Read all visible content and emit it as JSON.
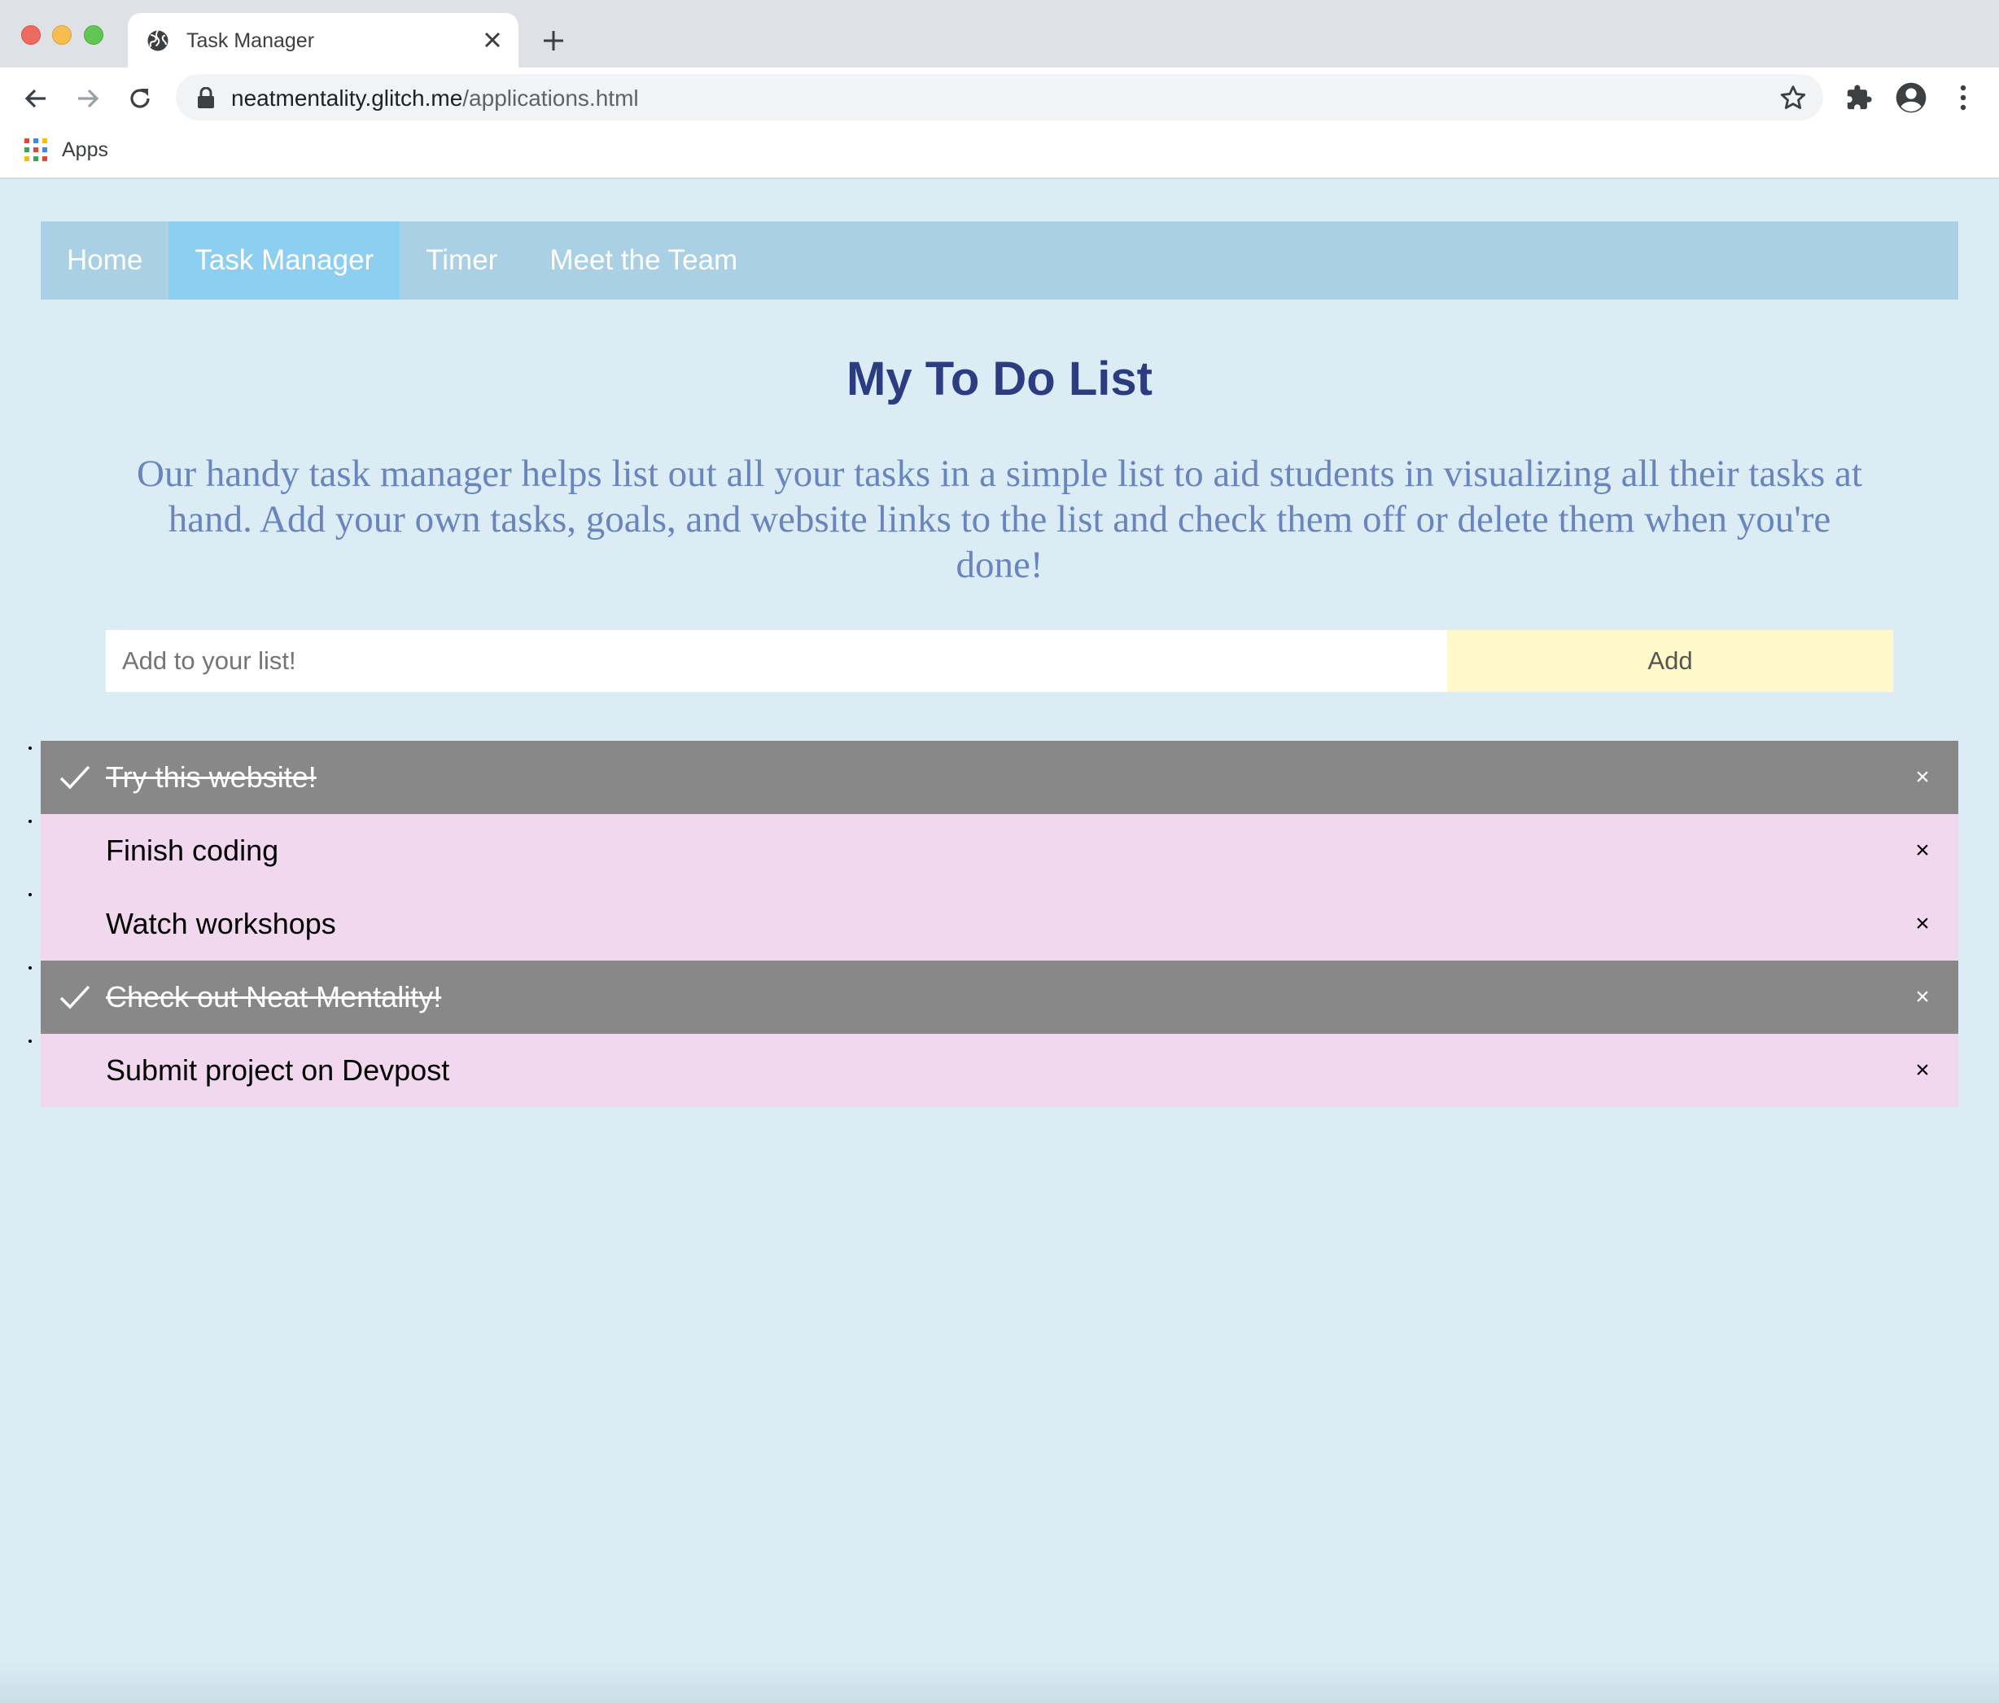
{
  "browser": {
    "tab_title": "Task Manager",
    "url_host": "neatmentality.glitch.me",
    "url_path": "/applications.html",
    "bookmarks_apps_label": "Apps"
  },
  "nav": {
    "items": [
      {
        "label": "Home",
        "active": false
      },
      {
        "label": "Task Manager",
        "active": true
      },
      {
        "label": "Timer",
        "active": false
      },
      {
        "label": "Meet the Team",
        "active": false
      }
    ]
  },
  "page": {
    "title": "My To Do List",
    "description": "Our handy task manager helps list out all your tasks in a simple list to aid students in visualizing all their tasks at hand. Add your own tasks, goals, and website links to the list and check them off or delete them when you're done!",
    "input_placeholder": "Add to your list!",
    "add_label": "Add"
  },
  "tasks": [
    {
      "text": "Try this website!",
      "checked": true
    },
    {
      "text": "Finish coding",
      "checked": false
    },
    {
      "text": "Watch workshops",
      "checked": false
    },
    {
      "text": "Check out Neat Mentality!",
      "checked": true
    },
    {
      "text": "Submit project on Devpost",
      "checked": false
    }
  ],
  "close_glyph": "×",
  "colors": {
    "background": "#dbecf5",
    "nav_bar": "#a9d0e4",
    "nav_active": "#8dcff1",
    "title": "#2b3d80",
    "description": "#6985bd",
    "add_button": "#fff9c9",
    "task_unchecked": "#f1d8ee",
    "task_checked": "#888888"
  }
}
